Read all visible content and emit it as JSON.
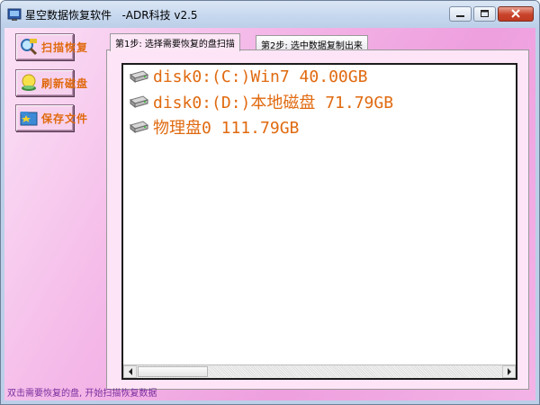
{
  "window": {
    "title": "星空数据恢复软件   -ADR科技 v2.5",
    "controls": [
      "minimize",
      "maximize",
      "close"
    ]
  },
  "sidebar": {
    "buttons": [
      {
        "label": "扫描恢复",
        "icon": "magnifier-icon"
      },
      {
        "label": "刷新磁盘",
        "icon": "refresh-disk-icon"
      },
      {
        "label": "保存文件",
        "icon": "save-file-icon"
      }
    ]
  },
  "tabs": [
    {
      "label": "第1步: 选择需要恢复的盘扫描",
      "active": true
    },
    {
      "label": "第2步: 选中数据复制出来",
      "active": false
    }
  ],
  "disks": [
    {
      "label": "disk0:(C:)Win7 40.00GB"
    },
    {
      "label": "disk0:(D:)本地磁盘 71.79GB"
    },
    {
      "label": "物理盘0 111.79GB"
    }
  ],
  "status_text": "双击需要恢复的盘, 开始扫描恢复数据",
  "colors": {
    "accent_text": "#e06a10",
    "status_text": "#7a2d9e",
    "background_pink": "#f4b8e8"
  }
}
